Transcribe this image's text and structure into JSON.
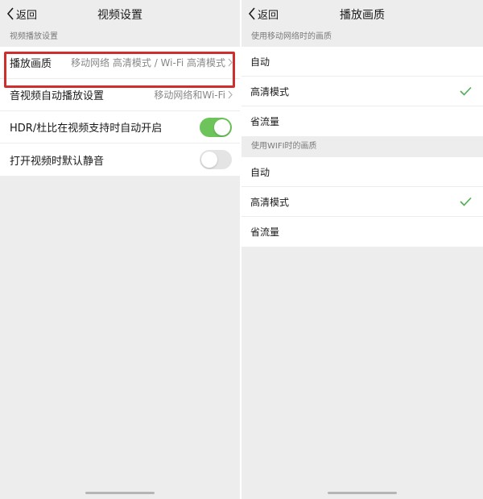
{
  "left": {
    "back_label": "返回",
    "title": "视频设置",
    "section_header": "视频播放设置",
    "rows": [
      {
        "label": "播放画质",
        "value": "移动网络 高清模式 / Wi-Fi 高清模式"
      },
      {
        "label": "音视频自动播放设置",
        "value": "移动网络和Wi-Fi"
      },
      {
        "label": "HDR/杜比在视频支持时自动开启",
        "toggle": "on"
      },
      {
        "label": "打开视频时默认静音",
        "toggle": "off"
      }
    ]
  },
  "right": {
    "back_label": "返回",
    "title": "播放画质",
    "mobile_header": "使用移动网络时的画质",
    "mobile_options": [
      {
        "label": "自动",
        "selected": false
      },
      {
        "label": "高清模式",
        "selected": true
      },
      {
        "label": "省流量",
        "selected": false
      }
    ],
    "wifi_header": "使用WIFI时的画质",
    "wifi_options": [
      {
        "label": "自动",
        "selected": false
      },
      {
        "label": "高清模式",
        "selected": true
      },
      {
        "label": "省流量",
        "selected": false
      }
    ]
  },
  "colors": {
    "toggle_on": "#6cc45a",
    "check": "#4caf50",
    "highlight": "#cf2e2e",
    "background": "#ededed"
  },
  "icons": [
    "chevron-left-icon",
    "chevron-right-icon",
    "checkmark-icon",
    "toggle-switch"
  ]
}
